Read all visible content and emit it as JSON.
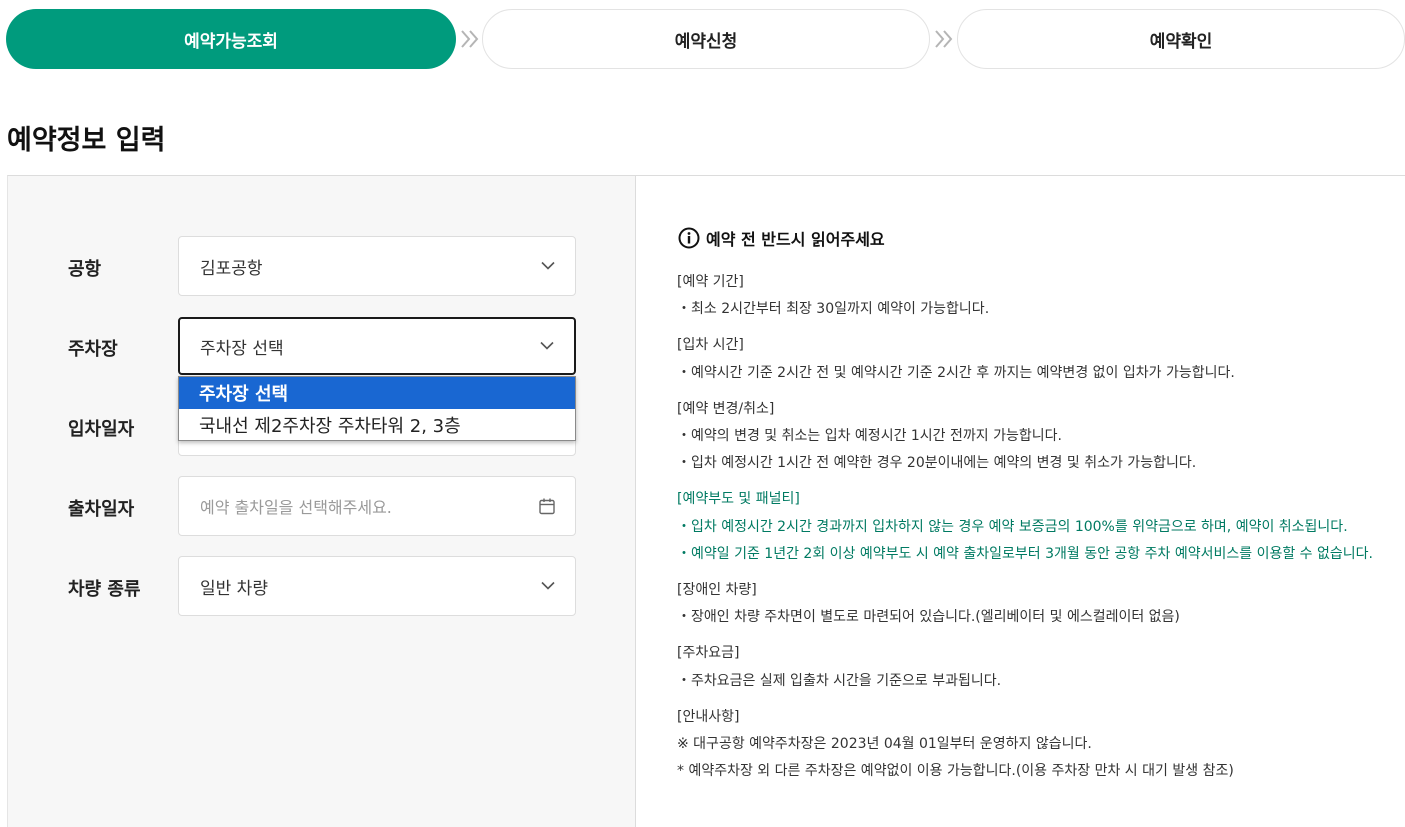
{
  "steps": [
    {
      "label": "예약가능조회",
      "active": true
    },
    {
      "label": "예약신청",
      "active": false
    },
    {
      "label": "예약확인",
      "active": false
    }
  ],
  "page_title": "예약정보 입력",
  "form": {
    "airport": {
      "label": "공항",
      "value": "김포공항"
    },
    "parking": {
      "label": "주차장",
      "value": "주차장 선택"
    },
    "entry_date": {
      "label": "입차일자",
      "placeholder": ""
    },
    "exit_date": {
      "label": "출차일자",
      "placeholder": "예약 출차일을 선택해주세요."
    },
    "vehicle": {
      "label": "차량 종류",
      "value": "일반 차량"
    }
  },
  "dropdown": {
    "options": [
      "주차장 선택",
      "국내선 제2주차장 주차타워 2, 3층"
    ],
    "selected_index": 0
  },
  "notice": {
    "heading": "예약 전 반드시 읽어주세요",
    "sections": [
      {
        "title": "[예약 기간]",
        "items": [
          "・최소 2시간부터 최장 30일까지 예약이 가능합니다."
        ]
      },
      {
        "title": "[입차 시간]",
        "items": [
          "・예약시간 기준 2시간 전 및 예약시간 기준 2시간 후 까지는 예약변경 없이 입차가 가능합니다."
        ]
      },
      {
        "title": "[예약 변경/취소]",
        "items": [
          "・예약의 변경 및 취소는 입차 예정시간 1시간 전까지 가능합니다.",
          "・입차 예정시간 1시간 전 예약한 경우 20분이내에는 예약의 변경 및 취소가 가능합니다."
        ]
      },
      {
        "title": "[예약부도 및 패널티]",
        "items": [
          "・입차 예정시간 2시간 경과까지 입차하지 않는 경우 예약 보증금의 100%를 위약금으로 하며, 예약이 취소됩니다.",
          "・예약일 기준 1년간 2회 이상 예약부도 시 예약 출차일로부터 3개월 동안 공항 주차 예약서비스를 이용할 수 없습니다."
        ]
      },
      {
        "title": "[장애인 차량]",
        "items": [
          "・장애인 차량 주차면이 별도로 마련되어 있습니다.(엘리베이터 및 에스컬레이터 없음)"
        ]
      },
      {
        "title": "[주차요금]",
        "items": [
          "・주차요금은 실제 입출차 시간을 기준으로 부과됩니다."
        ]
      },
      {
        "title": "[안내사항]",
        "items": [
          "※ 대구공항 예약주차장은 2023년 04월 01일부터 운영하지 않습니다.",
          "* 예약주차장 외 다른 주차장은 예약없이 이용 가능합니다.(이용 주차장 만차 시 대기 발생 참조)"
        ]
      }
    ]
  },
  "colors": {
    "accent": "#009b7d",
    "penalty_text": "#007a62",
    "dropdown_selected": "#1967d2"
  }
}
